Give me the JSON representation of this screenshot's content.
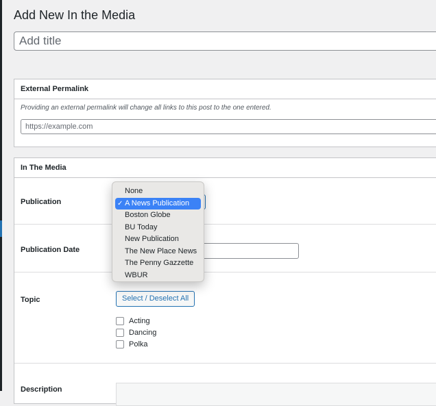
{
  "page": {
    "title": "Add New In the Media",
    "title_placeholder": "Add title"
  },
  "external_permalink": {
    "heading": "External Permalink",
    "description": "Providing an external permalink will change all links to this post to the one entered.",
    "url_placeholder": "https://example.com"
  },
  "in_the_media": {
    "heading": "In The Media",
    "publication_label": "Publication",
    "publication_date_label": "Publication Date",
    "topic_label": "Topic",
    "select_all_label": "Select / Deselect All",
    "topics": [
      "Acting",
      "Dancing",
      "Polka"
    ],
    "description_label": "Description"
  },
  "publication_dropdown": {
    "selected": "A News Publication",
    "options": [
      "None",
      "A News Publication",
      "Boston Globe",
      "BU Today",
      "New Publication",
      "The New Place News",
      "The Penny Gazzette",
      "WBUR"
    ],
    "check_glyph": "✓"
  },
  "colors": {
    "accent": "#2271b1",
    "selection": "#3b82f6"
  }
}
